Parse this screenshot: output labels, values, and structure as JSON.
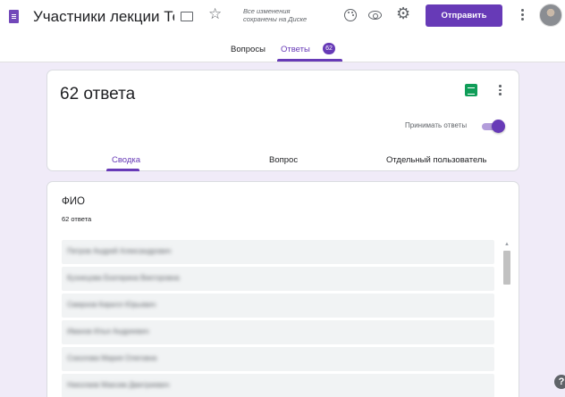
{
  "header": {
    "title": "Участники лекции Тех",
    "save_status": "Все изменения сохранены на Диске",
    "send_label": "Отправить"
  },
  "tabs": {
    "questions": "Вопросы",
    "answers": "Ответы",
    "answers_badge": "62"
  },
  "summary": {
    "response_count": "62 ответа",
    "accept_label": "Принимать ответы",
    "accepting": true,
    "subtabs": [
      "Сводка",
      "Вопрос",
      "Отдельный пользователь"
    ]
  },
  "question": {
    "title": "ФИО",
    "count": "62 ответа",
    "answers": [
      "Петров Андрей Александрович",
      "Кузнецова Екатерина Викторовна",
      "Смирнов Кирилл Юрьевич",
      "Иванов Илья Андреевич",
      "Соколова Мария Олеговна",
      "Николаев Максим Дмитриевич"
    ]
  },
  "colors": {
    "accent": "#673ab7",
    "background": "#f0ebf8",
    "sheets": "#0f9d58"
  },
  "icons": [
    "forms-doc-icon",
    "folder-icon",
    "star-icon",
    "palette-icon",
    "eye-icon",
    "gear-icon",
    "more-vert-icon",
    "sheets-icon",
    "help-icon"
  ]
}
